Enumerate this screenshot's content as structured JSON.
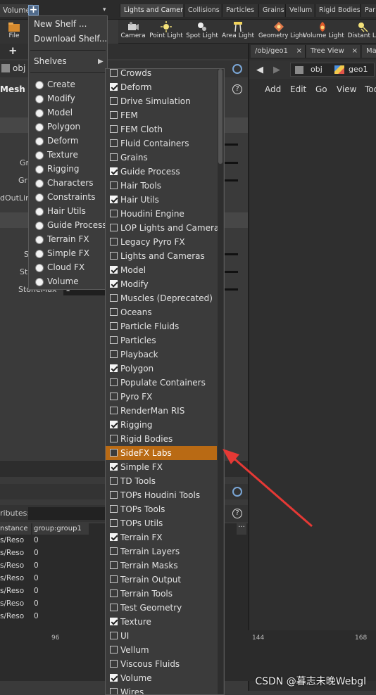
{
  "shelf_tabs_left": {
    "volume_tab": "Volume",
    "add_label": "+",
    "menu_arrow": "▾"
  },
  "shelf_tabs_right": [
    "Lights and Cameras",
    "Collisions",
    "Particles",
    "Grains",
    "Vellum",
    "Rigid Bodies",
    "Par"
  ],
  "shelf_tools": {
    "file_label": "File",
    "tools": [
      "Camera",
      "Point Light",
      "Spot Light",
      "Area Light",
      "Geometry Light",
      "Volume Light",
      "Distant Li"
    ]
  },
  "left_pane": {
    "plus_label": "+",
    "path_label": "obj",
    "mesh_label": "Mesh",
    "params": [
      "Gr",
      "Gr",
      "dOutLine",
      "S",
      "St",
      "StoneMax"
    ],
    "stonemax_value": "1",
    "attributes_label": "ributes:",
    "table_headers": [
      "nstance",
      "group:group1"
    ],
    "table_rows": [
      [
        "s/Reso",
        "0"
      ],
      [
        "s/Reso",
        "0"
      ],
      [
        "s/Reso",
        "0"
      ],
      [
        "s/Reso",
        "0"
      ],
      [
        "s/Reso",
        "0"
      ],
      [
        "s/Reso",
        "0"
      ],
      [
        "s/Reso",
        "0"
      ]
    ]
  },
  "right_pane": {
    "tabs": [
      "/obj/geo1",
      "Tree View",
      "Mat"
    ],
    "path_obj": "obj",
    "path_geo": "geo1",
    "menu": [
      "Add",
      "Edit",
      "Go",
      "View",
      "Too"
    ]
  },
  "shelf_menu": {
    "new_shelf": "New Shelf ...",
    "download_shelf": "Download Shelf...",
    "shelves": "Shelves",
    "shelves_arrow": "▶",
    "shelf_sets": [
      "Create",
      "Modify",
      "Model",
      "Polygon",
      "Deform",
      "Texture",
      "Rigging",
      "Characters",
      "Constraints",
      "Hair Utils",
      "Guide Process",
      "Terrain FX",
      "Simple FX",
      "Cloud FX",
      "Volume"
    ]
  },
  "shelf_submenu": {
    "items": [
      {
        "label": "Crowds",
        "checked": false
      },
      {
        "label": "Deform",
        "checked": true
      },
      {
        "label": "Drive Simulation",
        "checked": false
      },
      {
        "label": "FEM",
        "checked": false
      },
      {
        "label": "FEM Cloth",
        "checked": false
      },
      {
        "label": "Fluid Containers",
        "checked": false
      },
      {
        "label": "Grains",
        "checked": false
      },
      {
        "label": "Guide Process",
        "checked": true
      },
      {
        "label": "Hair Tools",
        "checked": false
      },
      {
        "label": "Hair Utils",
        "checked": true
      },
      {
        "label": "Houdini Engine",
        "checked": false
      },
      {
        "label": "LOP Lights and Cameras",
        "checked": false
      },
      {
        "label": "Legacy Pyro FX",
        "checked": false
      },
      {
        "label": "Lights and Cameras",
        "checked": false
      },
      {
        "label": "Model",
        "checked": true
      },
      {
        "label": "Modify",
        "checked": true
      },
      {
        "label": "Muscles (Deprecated)",
        "checked": false
      },
      {
        "label": "Oceans",
        "checked": false
      },
      {
        "label": "Particle Fluids",
        "checked": false
      },
      {
        "label": "Particles",
        "checked": false
      },
      {
        "label": "Playback",
        "checked": false
      },
      {
        "label": "Polygon",
        "checked": true
      },
      {
        "label": "Populate Containers",
        "checked": false
      },
      {
        "label": "Pyro FX",
        "checked": false
      },
      {
        "label": "RenderMan RIS",
        "checked": false
      },
      {
        "label": "Rigging",
        "checked": true
      },
      {
        "label": "Rigid Bodies",
        "checked": false
      },
      {
        "label": "SideFX Labs",
        "checked": false,
        "highlight": true
      },
      {
        "label": "Simple FX",
        "checked": true
      },
      {
        "label": "TD Tools",
        "checked": false
      },
      {
        "label": "TOPs Houdini Tools",
        "checked": false
      },
      {
        "label": "TOPs Tools",
        "checked": false
      },
      {
        "label": "TOPs Utils",
        "checked": false
      },
      {
        "label": "Terrain FX",
        "checked": true
      },
      {
        "label": "Terrain Layers",
        "checked": false
      },
      {
        "label": "Terrain Masks",
        "checked": false
      },
      {
        "label": "Terrain Output",
        "checked": false
      },
      {
        "label": "Terrain Tools",
        "checked": false
      },
      {
        "label": "Test Geometry",
        "checked": false
      },
      {
        "label": "Texture",
        "checked": true
      },
      {
        "label": "UI",
        "checked": false
      },
      {
        "label": "Vellum",
        "checked": false
      },
      {
        "label": "Viscous Fluids",
        "checked": false
      },
      {
        "label": "Volume",
        "checked": true
      },
      {
        "label": "Wires",
        "checked": false
      }
    ]
  },
  "timeline": {
    "ticks": [
      "96",
      "144",
      "168"
    ]
  },
  "watermark": "CSDN @暮志未晚Webgl",
  "colors": {
    "highlight": "#b96a14",
    "arrow": "#e53935"
  }
}
